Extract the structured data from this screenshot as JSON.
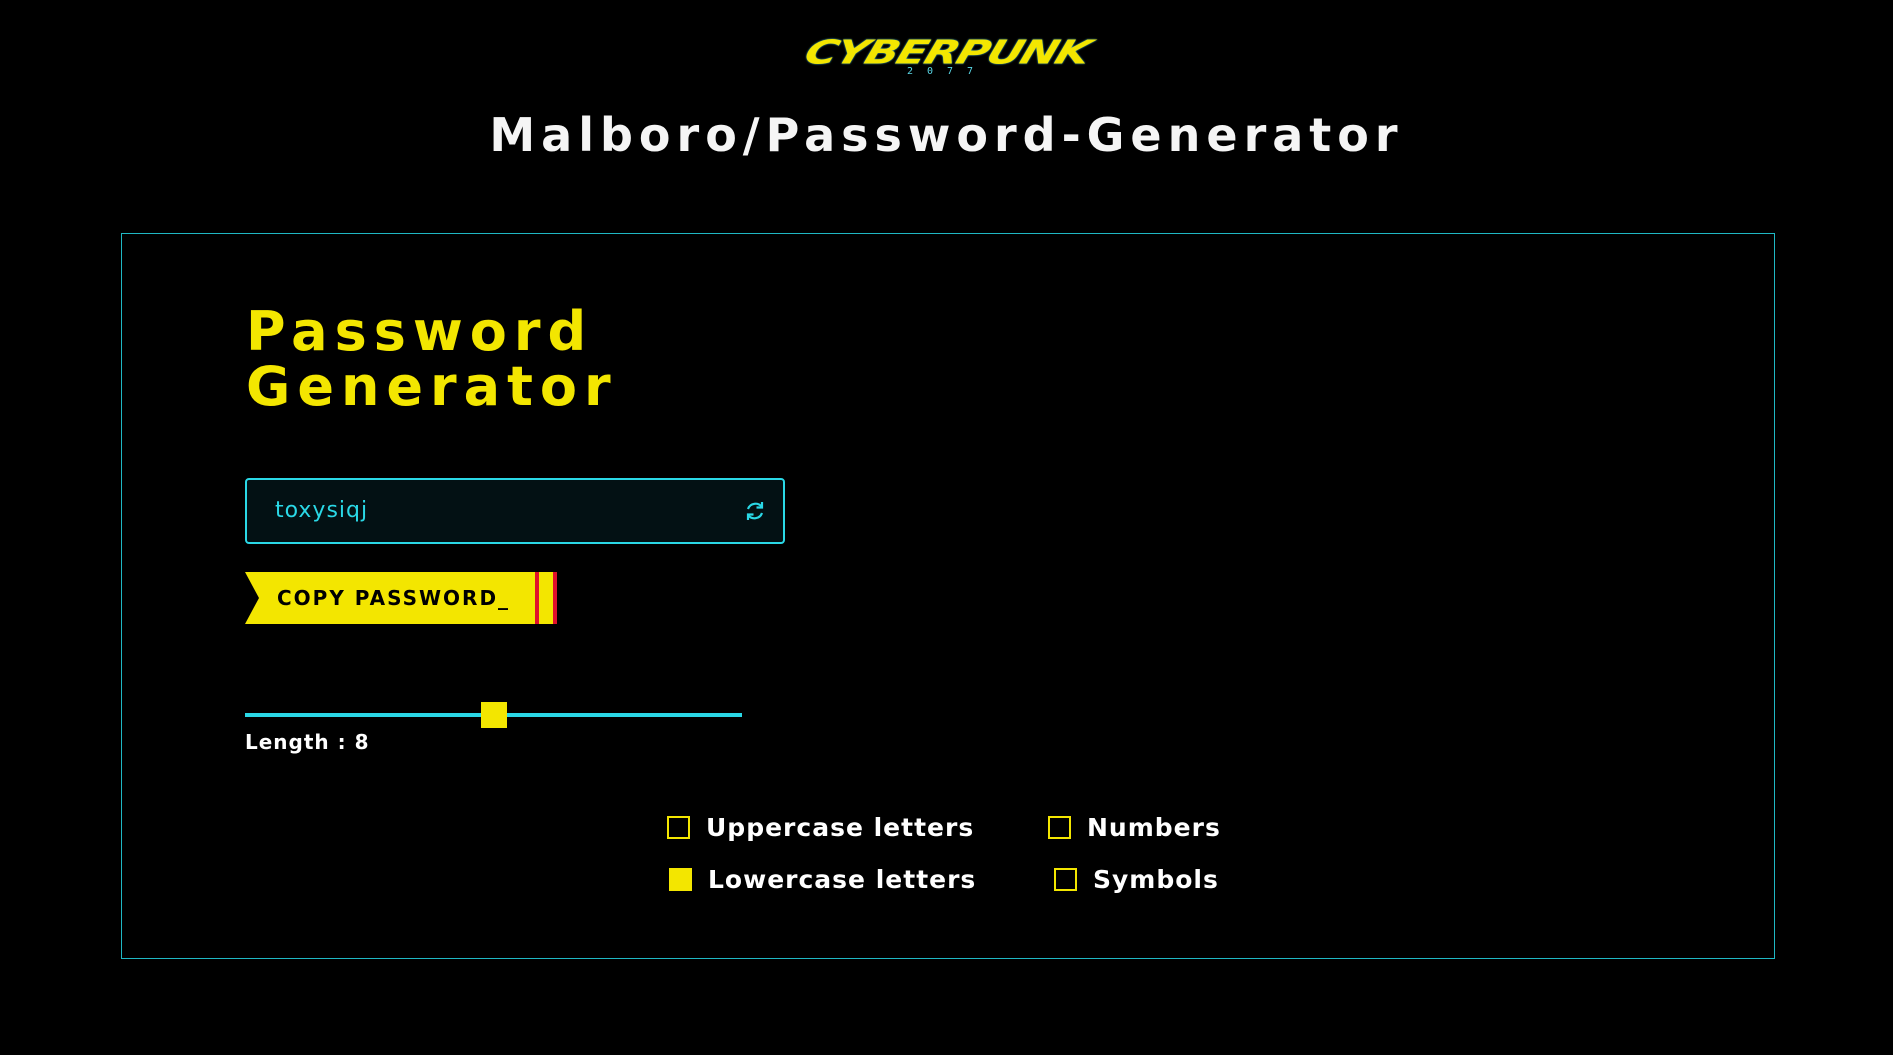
{
  "logo": {
    "text": "CYBERPUNK",
    "subtext": "2077",
    "color": "#f3e600"
  },
  "site_title": "Malboro/Password-Generator",
  "panel": {
    "heading_line1": "Password",
    "heading_line2": "Generator",
    "password_value": "toxysiqj",
    "refresh_icon": "refresh-icon",
    "copy_button_label": "COPY PASSWORD_",
    "length": {
      "label": "Length : 8",
      "value": 8,
      "fraction": 0.5
    },
    "options": [
      {
        "label": "Uppercase letters",
        "checked": false
      },
      {
        "label": "Numbers",
        "checked": false
      },
      {
        "label": "Lowercase letters",
        "checked": true
      },
      {
        "label": "Symbols",
        "checked": false
      }
    ]
  },
  "colors": {
    "accent_yellow": "#f3e600",
    "accent_cyan": "#2ad8e6",
    "border_cyan": "#1fb8c4",
    "background": "#000000",
    "button_stripe_red": "#e0112b"
  }
}
